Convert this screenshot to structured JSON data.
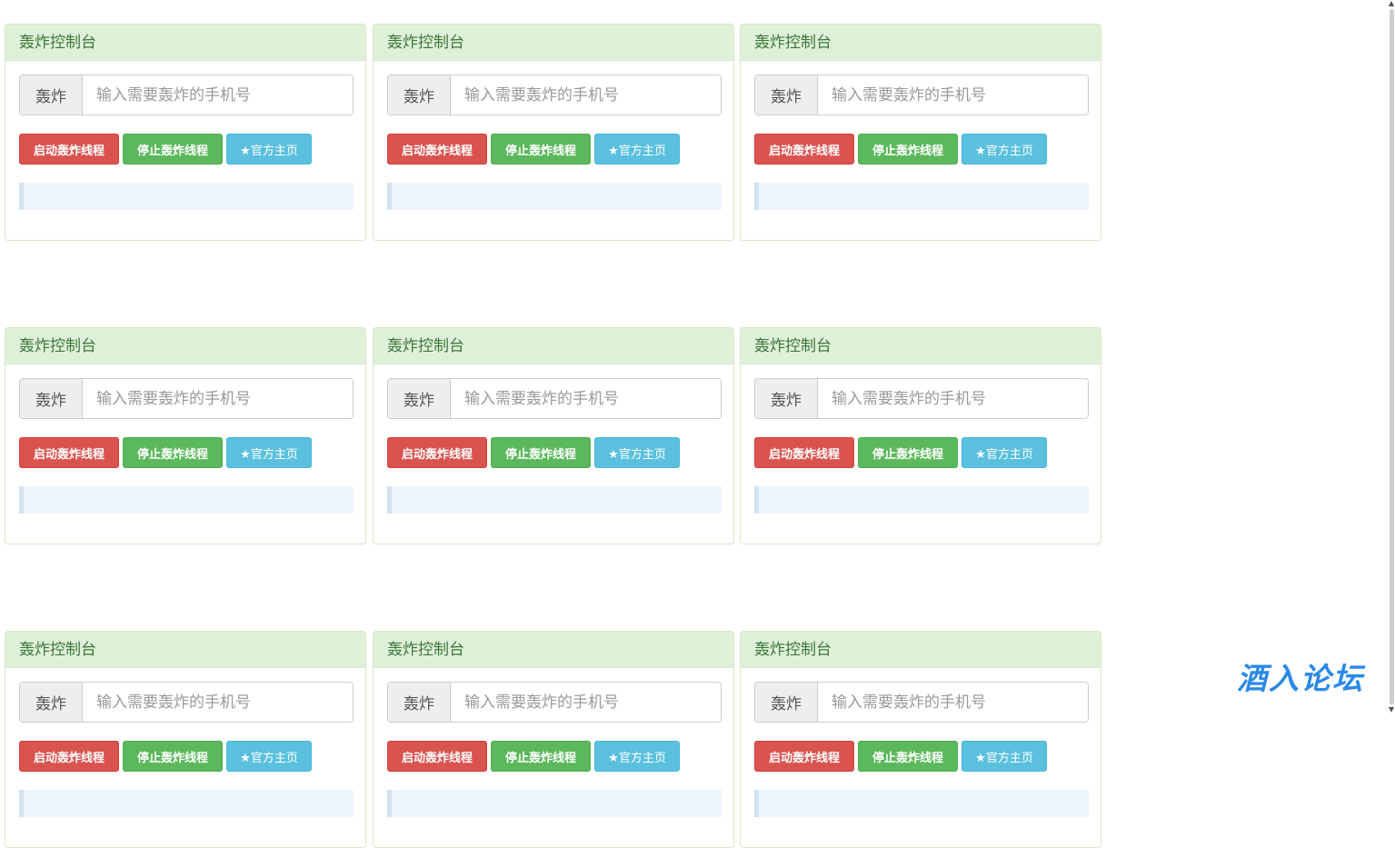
{
  "panels": [
    {
      "heading": "轰炸控制台",
      "addon": "轰炸",
      "placeholder": "输入需要轰炸的手机号",
      "value": "",
      "start_label": "启动轰炸线程",
      "stop_label": "停止轰炸线程",
      "home_label": "★官方主页",
      "log": ""
    },
    {
      "heading": "轰炸控制台",
      "addon": "轰炸",
      "placeholder": "输入需要轰炸的手机号",
      "value": "",
      "start_label": "启动轰炸线程",
      "stop_label": "停止轰炸线程",
      "home_label": "★官方主页",
      "log": ""
    },
    {
      "heading": "轰炸控制台",
      "addon": "轰炸",
      "placeholder": "输入需要轰炸的手机号",
      "value": "",
      "start_label": "启动轰炸线程",
      "stop_label": "停止轰炸线程",
      "home_label": "★官方主页",
      "log": ""
    },
    {
      "heading": "轰炸控制台",
      "addon": "轰炸",
      "placeholder": "输入需要轰炸的手机号",
      "value": "",
      "start_label": "启动轰炸线程",
      "stop_label": "停止轰炸线程",
      "home_label": "★官方主页",
      "log": ""
    },
    {
      "heading": "轰炸控制台",
      "addon": "轰炸",
      "placeholder": "输入需要轰炸的手机号",
      "value": "",
      "start_label": "启动轰炸线程",
      "stop_label": "停止轰炸线程",
      "home_label": "★官方主页",
      "log": ""
    },
    {
      "heading": "轰炸控制台",
      "addon": "轰炸",
      "placeholder": "输入需要轰炸的手机号",
      "value": "",
      "start_label": "启动轰炸线程",
      "stop_label": "停止轰炸线程",
      "home_label": "★官方主页",
      "log": ""
    },
    {
      "heading": "轰炸控制台",
      "addon": "轰炸",
      "placeholder": "输入需要轰炸的手机号",
      "value": "",
      "start_label": "启动轰炸线程",
      "stop_label": "停止轰炸线程",
      "home_label": "★官方主页",
      "log": ""
    },
    {
      "heading": "轰炸控制台",
      "addon": "轰炸",
      "placeholder": "输入需要轰炸的手机号",
      "value": "",
      "start_label": "启动轰炸线程",
      "stop_label": "停止轰炸线程",
      "home_label": "★官方主页",
      "log": ""
    },
    {
      "heading": "轰炸控制台",
      "addon": "轰炸",
      "placeholder": "输入需要轰炸的手机号",
      "value": "",
      "start_label": "启动轰炸线程",
      "stop_label": "停止轰炸线程",
      "home_label": "★官方主页",
      "log": ""
    }
  ],
  "watermark": "酒入论坛",
  "colors": {
    "heading_bg": "#dff0d8",
    "heading_text": "#3c763d",
    "danger": "#d9534f",
    "success": "#5cb85c",
    "info": "#5bc0de",
    "log_bg": "#eef5fd",
    "watermark": "#2a89e6"
  },
  "icons": {
    "star": "star-icon"
  }
}
